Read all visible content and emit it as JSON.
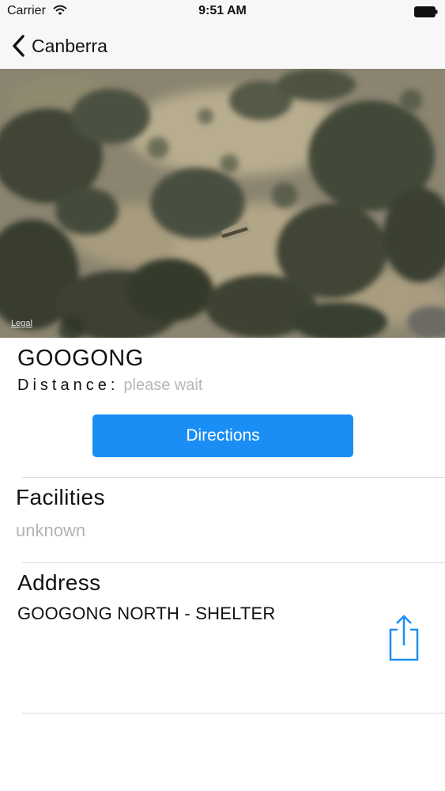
{
  "status_bar": {
    "carrier": "Carrier",
    "time": "9:51 AM"
  },
  "nav": {
    "back_label": "Canberra"
  },
  "map": {
    "legal_label": "Legal"
  },
  "place": {
    "name": "GOOGONG",
    "distance_label": "Distance:",
    "distance_value": "please wait",
    "directions_label": "Directions"
  },
  "facilities": {
    "heading": "Facilities",
    "value": "unknown"
  },
  "address": {
    "heading": "Address",
    "value": "GOOGONG NORTH - SHELTER"
  },
  "colors": {
    "accent": "#1a8ef5",
    "muted_text": "#b3b3b3"
  }
}
